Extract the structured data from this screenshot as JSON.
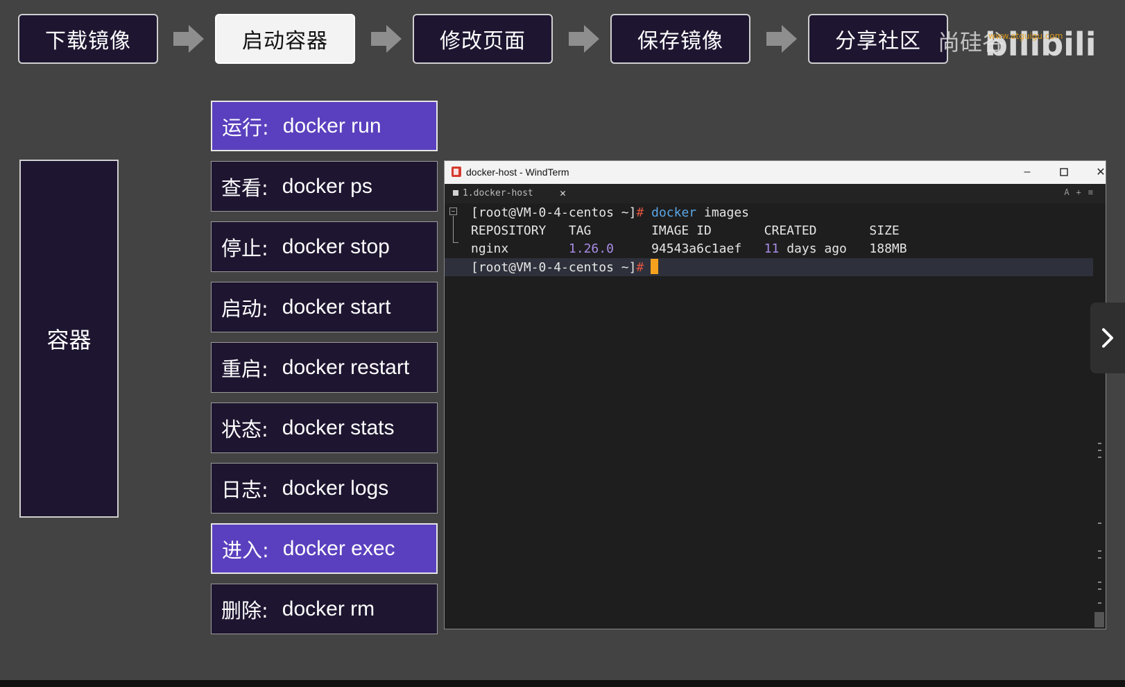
{
  "workflow": {
    "steps": [
      "下载镜像",
      "启动容器",
      "修改页面",
      "保存镜像",
      "分享社区"
    ],
    "active_index": 1
  },
  "watermark": {
    "text": "尚硅谷",
    "logo_text": "bilibili",
    "site": "www.atguigu.com"
  },
  "panel": {
    "label": "容器"
  },
  "commands": [
    {
      "label": "运行:",
      "command": "docker run"
    },
    {
      "label": "查看:",
      "command": "docker ps"
    },
    {
      "label": "停止:",
      "command": "docker stop"
    },
    {
      "label": "启动:",
      "command": "docker start"
    },
    {
      "label": "重启:",
      "command": "docker restart"
    },
    {
      "label": "状态:",
      "command": "docker stats"
    },
    {
      "label": "日志:",
      "command": "docker logs"
    },
    {
      "label": "进入:",
      "command": "docker exec"
    },
    {
      "label": "删除:",
      "command": "docker rm"
    }
  ],
  "highlighted_commands": [
    0,
    7
  ],
  "terminal": {
    "window_title": "docker-host - WindTerm",
    "tab_label": "1.docker-host",
    "prompt": "[root@VM-0-4-centos ~]",
    "prompt_symbol": "#",
    "command_word": "docker",
    "command_arg": " images",
    "header": "REPOSITORY   TAG        IMAGE ID       CREATED       SIZE",
    "row": {
      "repository": "nginx",
      "tag": "1.26.0",
      "image_id": "94543a6c1aef",
      "created_num": "11",
      "created_rest": " days ago",
      "size": "188MB"
    }
  },
  "colors": {
    "background": "#434343",
    "panel_bg": "#1e1530",
    "highlight": "#5a40be",
    "cursor": "#f6a21e"
  }
}
